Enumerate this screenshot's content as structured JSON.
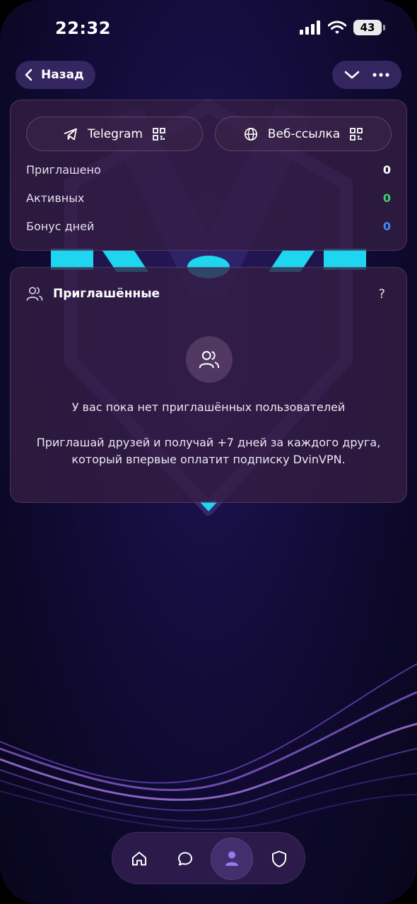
{
  "status_bar": {
    "time": "22:32",
    "battery": "43"
  },
  "nav": {
    "back_label": "Назад"
  },
  "links": {
    "telegram_label": "Telegram",
    "web_label": "Веб-ссылка"
  },
  "stats": [
    {
      "label": "Приглашено",
      "value": "0",
      "color": "#ffffff"
    },
    {
      "label": "Активных",
      "value": "0",
      "color": "#3fd36a"
    },
    {
      "label": "Бонус дней",
      "value": "0",
      "color": "#3a8cff"
    }
  ],
  "invited": {
    "title": "Приглашённые",
    "help": "?",
    "empty_title": "У вас пока нет приглашённых пользователей",
    "empty_desc": "Приглашай друзей и получай +7 дней за каждого друга, который впервые оплатит подписку DvinVPN."
  },
  "bottom_nav": {
    "items": [
      {
        "icon": "home-icon"
      },
      {
        "icon": "chat-icon"
      },
      {
        "icon": "profile-icon",
        "active": true
      },
      {
        "icon": "shield-icon"
      }
    ]
  },
  "colors": {
    "accent_cyan": "#1fd6f0",
    "accent_purple": "#8b5cf6"
  }
}
